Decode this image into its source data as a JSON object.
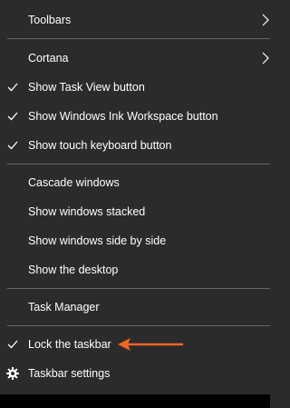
{
  "menu": {
    "toolbars": {
      "label": "Toolbars",
      "has_submenu": true
    },
    "cortana": {
      "label": "Cortana",
      "has_submenu": true
    },
    "task_view": {
      "label": "Show Task View button",
      "checked": true
    },
    "ink_workspace": {
      "label": "Show Windows Ink Workspace button",
      "checked": true
    },
    "touch_keyboard": {
      "label": "Show touch keyboard button",
      "checked": true
    },
    "cascade": {
      "label": "Cascade windows"
    },
    "stacked": {
      "label": "Show windows stacked"
    },
    "side_by_side": {
      "label": "Show windows side by side"
    },
    "desktop": {
      "label": "Show the desktop"
    },
    "task_manager": {
      "label": "Task Manager"
    },
    "lock_taskbar": {
      "label": "Lock the taskbar",
      "checked": true
    },
    "taskbar_settings": {
      "label": "Taskbar settings",
      "icon": "gear-icon"
    }
  },
  "colors": {
    "menu_background": "#2b2b2b",
    "text": "#ffffff",
    "separator": "#656565",
    "annotation_arrow": "#f26522"
  }
}
